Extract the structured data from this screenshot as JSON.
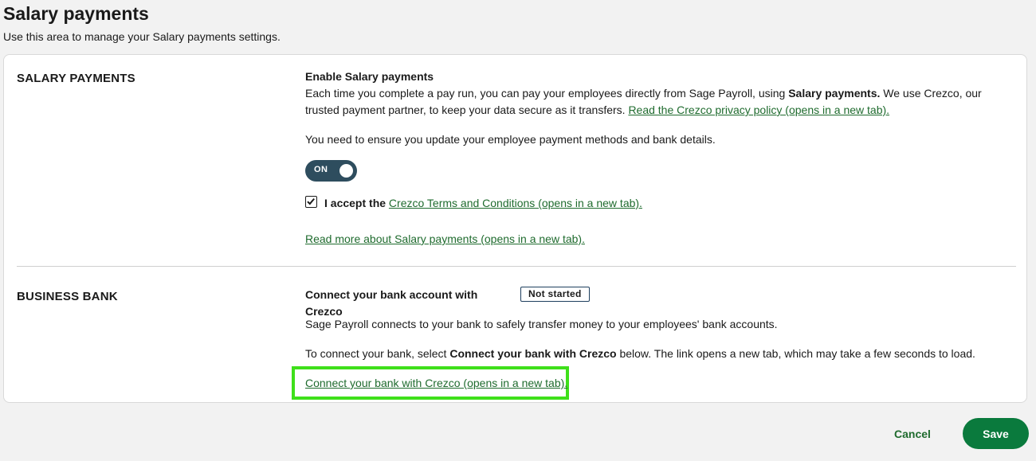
{
  "page": {
    "title": "Salary payments",
    "subtitle": "Use this area to manage your Salary payments settings."
  },
  "salary_section": {
    "heading": "SALARY PAYMENTS",
    "enable_title": "Enable Salary payments",
    "desc_part1": "Each time you complete a pay run, you can pay your employees directly from Sage Payroll, using ",
    "desc_bold": "Salary payments.",
    "desc_part2": " We use Crezco, our trusted payment partner, to keep your data secure as it transfers. ",
    "privacy_link": "Read the Crezco privacy policy (opens in a new tab).",
    "ensure_text": "You need to ensure you update your employee payment methods and bank details.",
    "toggle_label": "ON",
    "toggle_state": "on",
    "accept_checked": true,
    "accept_prefix": "I accept the",
    "terms_link": "Crezco Terms and Conditions (opens in a new tab).",
    "read_more_link": "Read more about Salary payments (opens in a new tab)."
  },
  "bank_section": {
    "heading": "BUSINESS BANK",
    "connect_title": "Connect your bank account with Crezco",
    "status_badge": "Not started",
    "connects_text": "Sage Payroll connects to your bank to safely transfer money to your employees' bank accounts.",
    "instr_part1": "To connect your bank, select ",
    "instr_bold": "Connect your bank with Crezco",
    "instr_part2": " below. The link opens a new tab, which may take a few seconds to load.",
    "connect_link": "Connect your bank with Crezco (opens in a new tab)."
  },
  "footer": {
    "cancel_label": "Cancel",
    "save_label": "Save"
  },
  "colors": {
    "accent_green": "#0a7a3d",
    "link_green": "#1f6b2e",
    "toggle_bg": "#2e4d5e",
    "highlight": "#3fe01a"
  }
}
